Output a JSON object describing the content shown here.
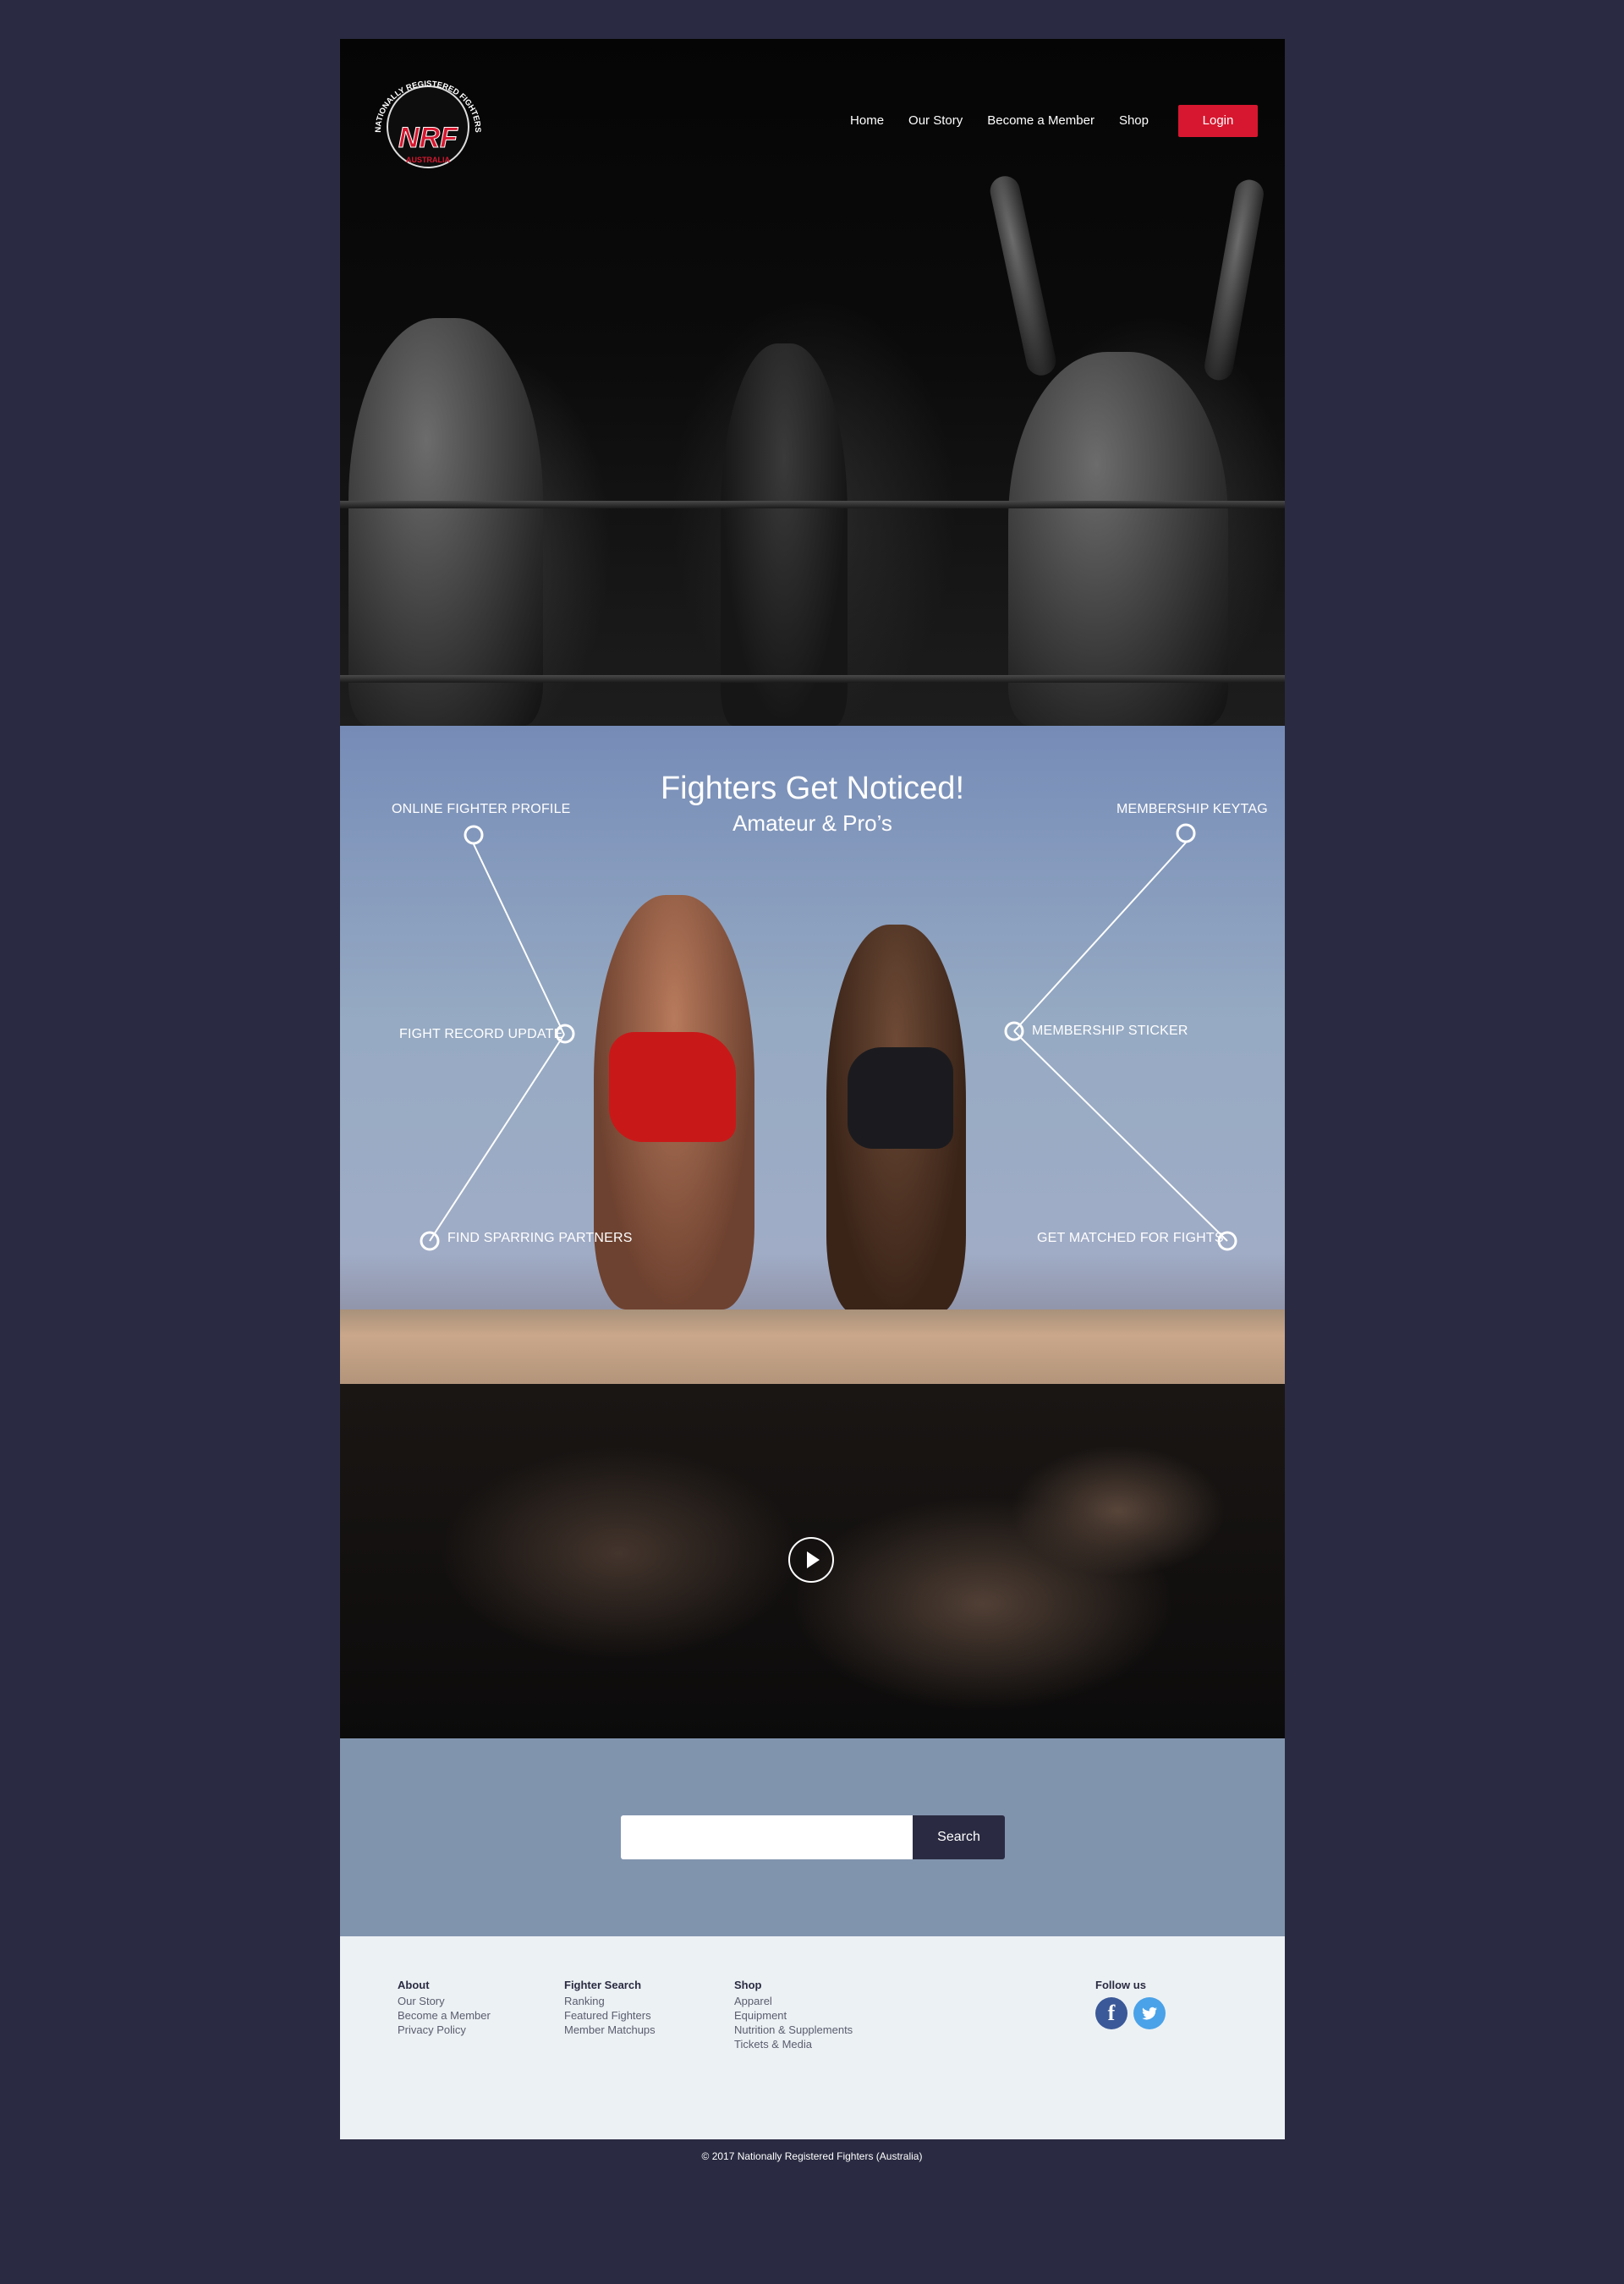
{
  "nav": {
    "items": [
      "Home",
      "Our Story",
      "Become a Member",
      "Shop"
    ],
    "login_label": "Login"
  },
  "logo": {
    "arc_text": "NATIONALLY REGISTERED FIGHTERS",
    "letters": "NRF",
    "country": "AUSTRALIA"
  },
  "features": {
    "title": "Fighters Get Noticed!",
    "subtitle": "Amateur & Pro’s",
    "left": [
      "ONLINE FIGHTER PROFILE",
      "FIGHT RECORD UPDATE",
      "FIND SPARRING PARTNERS"
    ],
    "right": [
      "MEMBERSHIP KEYTAG",
      "MEMBERSHIP STICKER",
      "GET MATCHED FOR FIGHTS"
    ]
  },
  "video": {
    "play_icon": "play-icon"
  },
  "search": {
    "button_label": "Search",
    "value": ""
  },
  "footer": {
    "columns": [
      {
        "heading": "About",
        "links": [
          "Our Story",
          "Become a Member",
          "Privacy Policy"
        ]
      },
      {
        "heading": "Fighter Search",
        "links": [
          "Ranking",
          "Featured Fighters",
          "Member Matchups"
        ]
      },
      {
        "heading": "Shop",
        "links": [
          "Apparel",
          "Equipment",
          "Nutrition & Supplements",
          "Tickets & Media"
        ]
      }
    ],
    "follow_label": "Follow us",
    "social": [
      "facebook-icon",
      "twitter-icon"
    ],
    "copyright": "© 2017 Nationally Registered Fighters (Australia)"
  },
  "colors": {
    "background": "#2a2b42",
    "accent": "#d7172f",
    "search_band": "#8194ae",
    "footer": "#ecf1f4",
    "facebook": "#3b5998",
    "twitter": "#4aa2e8"
  }
}
